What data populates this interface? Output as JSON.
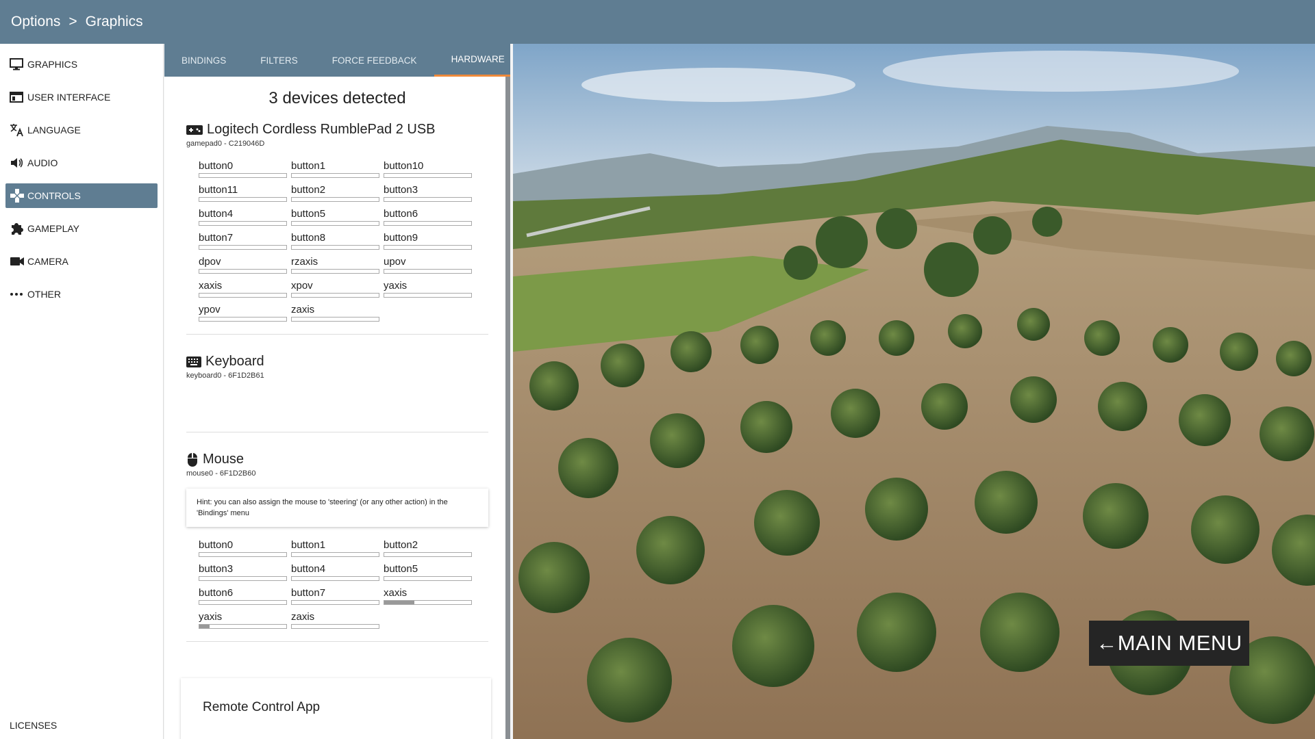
{
  "breadcrumb": {
    "root": "Options",
    "separator": ">",
    "current": "Graphics"
  },
  "sidebar": {
    "items": [
      {
        "label": "GRAPHICS",
        "icon": "monitor-icon",
        "active": false
      },
      {
        "label": "USER INTERFACE",
        "icon": "window-icon",
        "active": false
      },
      {
        "label": "LANGUAGE",
        "icon": "translate-icon",
        "active": false
      },
      {
        "label": "AUDIO",
        "icon": "speaker-icon",
        "active": false
      },
      {
        "label": "CONTROLS",
        "icon": "gamepad-cross-icon",
        "active": true
      },
      {
        "label": "GAMEPLAY",
        "icon": "puzzle-icon",
        "active": false
      },
      {
        "label": "CAMERA",
        "icon": "video-camera-icon",
        "active": false
      },
      {
        "label": "OTHER",
        "icon": "dots-icon",
        "active": false
      }
    ],
    "footer": "LICENSES"
  },
  "tabs": [
    {
      "label": "BINDINGS",
      "active": false
    },
    {
      "label": "FILTERS",
      "active": false
    },
    {
      "label": "FORCE FEEDBACK",
      "active": false
    },
    {
      "label": "HARDWARE",
      "active": true
    }
  ],
  "hardware": {
    "detected": "3 devices detected",
    "gamepad": {
      "name": "Logitech Cordless RumblePad 2 USB",
      "id": "gamepad0 - C219046D",
      "inputs": [
        {
          "label": "button0",
          "value": 0
        },
        {
          "label": "button1",
          "value": 0
        },
        {
          "label": "button10",
          "value": 0
        },
        {
          "label": "button11",
          "value": 0
        },
        {
          "label": "button2",
          "value": 0
        },
        {
          "label": "button3",
          "value": 0
        },
        {
          "label": "button4",
          "value": 0
        },
        {
          "label": "button5",
          "value": 0
        },
        {
          "label": "button6",
          "value": 0
        },
        {
          "label": "button7",
          "value": 0
        },
        {
          "label": "button8",
          "value": 0
        },
        {
          "label": "button9",
          "value": 0
        },
        {
          "label": "dpov",
          "value": 0
        },
        {
          "label": "rzaxis",
          "value": 0
        },
        {
          "label": "upov",
          "value": 0
        },
        {
          "label": "xaxis",
          "value": 0
        },
        {
          "label": "xpov",
          "value": 0
        },
        {
          "label": "yaxis",
          "value": 0
        },
        {
          "label": "ypov",
          "value": 0
        },
        {
          "label": "zaxis",
          "value": 0
        }
      ]
    },
    "keyboard": {
      "name": "Keyboard",
      "id": "keyboard0 - 6F1D2B61"
    },
    "mouse": {
      "name": "Mouse",
      "id": "mouse0 - 6F1D2B60",
      "hint": "Hint: you can also assign the mouse to 'steering' (or any other action) in the 'Bindings' menu",
      "inputs": [
        {
          "label": "button0",
          "value": 0
        },
        {
          "label": "button1",
          "value": 0
        },
        {
          "label": "button2",
          "value": 0
        },
        {
          "label": "button3",
          "value": 0
        },
        {
          "label": "button4",
          "value": 0
        },
        {
          "label": "button5",
          "value": 0
        },
        {
          "label": "button6",
          "value": 0
        },
        {
          "label": "button7",
          "value": 0
        },
        {
          "label": "xaxis",
          "value": 0.35
        },
        {
          "label": "yaxis",
          "value": 0.12
        },
        {
          "label": "zaxis",
          "value": 0
        }
      ]
    },
    "remote": {
      "title": "Remote Control App"
    }
  },
  "main_menu": {
    "arrow": "←",
    "label": "MAIN MENU"
  },
  "colors": {
    "accent": "#5f7d92",
    "tab_indicator": "#ef8a3a",
    "menu_button": "#252525"
  }
}
